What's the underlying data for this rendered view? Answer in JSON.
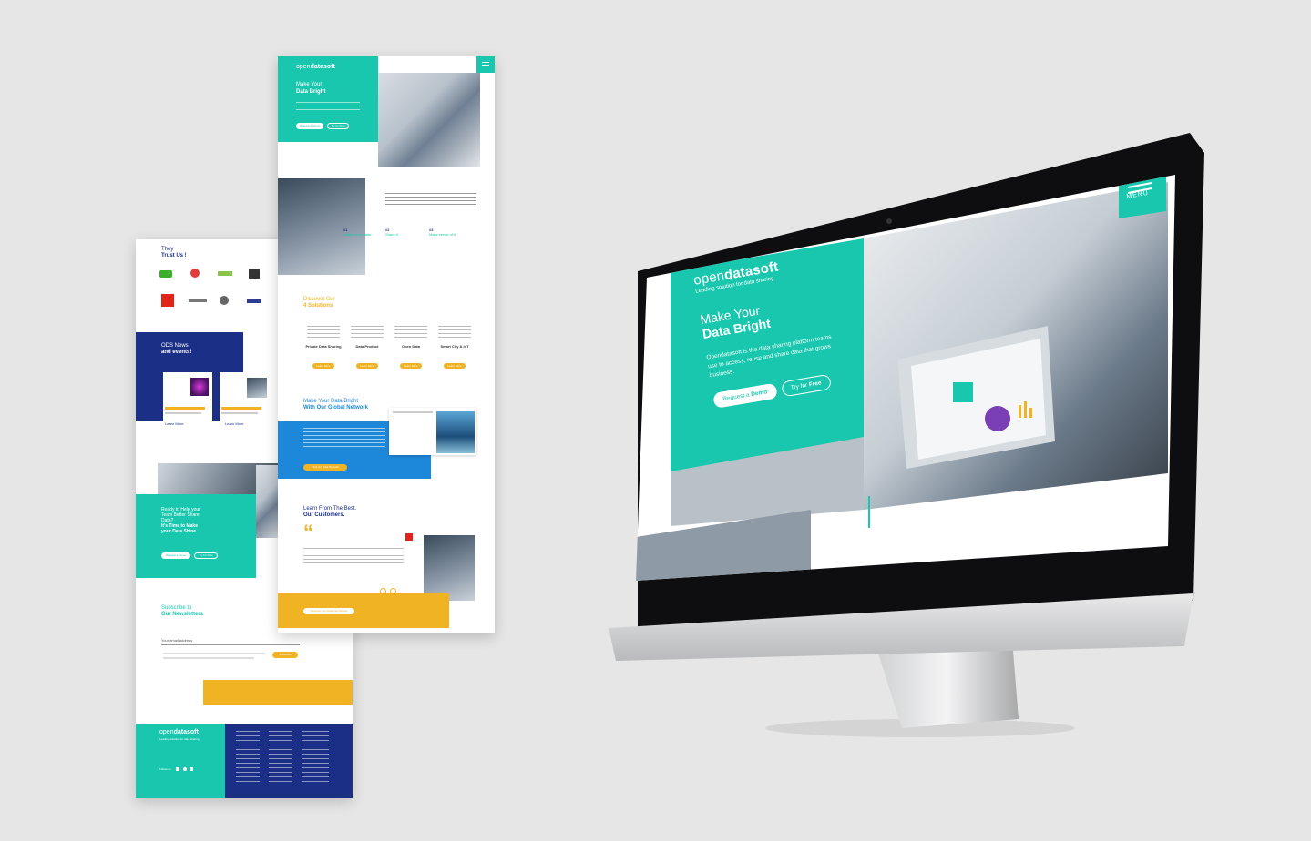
{
  "back_page": {
    "trust": {
      "line1": "They",
      "line2": "Trust Us !"
    },
    "news": {
      "line1": "ODS News",
      "line2": "and events!",
      "read_more": "Learn More",
      "read_more_2": "Learn More"
    },
    "help": {
      "line1": "Ready to Help your",
      "line2": "Team Better Share",
      "line3": "Data?",
      "line4": "It's Time to Make",
      "line5": "your Data Shine",
      "btn_demo": "Request a Demo",
      "btn_free": "Try for Free"
    },
    "newsletter": {
      "line1": "Subscribe to",
      "line2": "Our Newsletters",
      "email_label": "Your email address",
      "submit": "Subscribe"
    },
    "footer": {
      "logo_open": "open",
      "logo_data": "datasoft",
      "tagline": "Leading solution for data sharing",
      "follow": "Follow us"
    }
  },
  "front_page": {
    "logo_open": "open",
    "logo_data": "datasoft",
    "hero": {
      "line1": "Make Your",
      "line2": "Data Bright",
      "btn_demo": "Request a Demo",
      "btn_free": "Try for Free"
    },
    "steps": [
      {
        "num": "#1",
        "title": "Collect your data"
      },
      {
        "num": "#2",
        "title": "Share it"
      },
      {
        "num": "#3",
        "title": "Make sense of it"
      }
    ],
    "solutions": {
      "line1": "Discover Our",
      "line2": "4 Solutions",
      "items": [
        {
          "name": "Private Data Sharing",
          "btn": "Learn More"
        },
        {
          "name": "Data Product",
          "btn": "Learn More"
        },
        {
          "name": "Open Data",
          "btn": "Learn More"
        },
        {
          "name": "Smart City & IoT",
          "btn": "Learn More"
        }
      ]
    },
    "network": {
      "line1": "Make Your Data Bright",
      "line2": "With Our Global Network",
      "btn": "Find our Data Network"
    },
    "customers": {
      "line1": "Learn From The Best.",
      "line2": "Our Customers.",
      "quote_mark": "“",
      "btn": "Discover our Customer Stories"
    }
  },
  "imac": {
    "menu_label": "MENU",
    "logo_open": "open",
    "logo_data": "datasoft",
    "tagline": "Leading solution for data sharing",
    "hero_line1": "Make Your",
    "hero_line2": "Data Bright",
    "description": "Opendatasoft is the data sharing platform teams use to access, reuse and share data that grows business.",
    "btn_demo_prefix": "Request a",
    "btn_demo_bold": "Demo",
    "btn_free_prefix": "Try for",
    "btn_free_bold": "Free"
  },
  "colors": {
    "teal": "#18c7ae",
    "navy": "#1b2f86",
    "blue": "#1d87d9",
    "yellow": "#f0b323",
    "background": "#e6e6e6"
  },
  "icons": [
    "hamburger-menu-icon",
    "quote-icon",
    "linkedin-icon",
    "twitter-icon",
    "facebook-icon"
  ]
}
